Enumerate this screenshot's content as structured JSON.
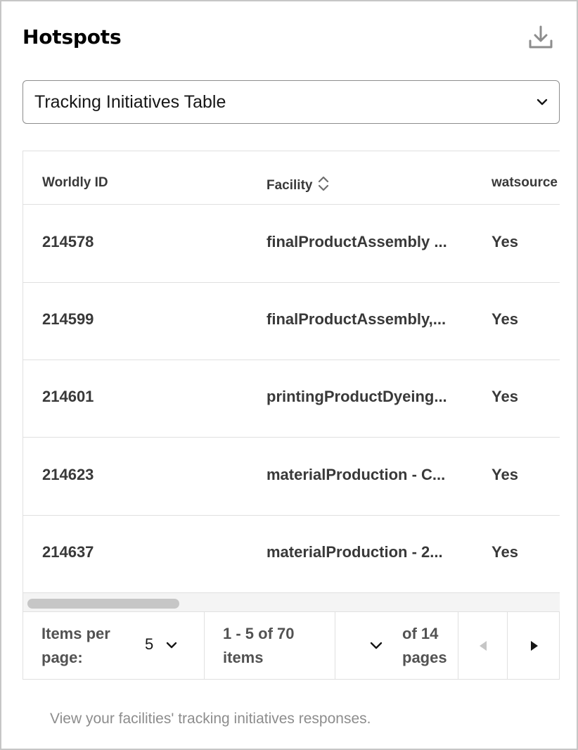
{
  "card": {
    "title": "Hotspots",
    "icons": {
      "download": "download-icon"
    }
  },
  "view_select": {
    "value": "Tracking Initiatives Table"
  },
  "table": {
    "columns": [
      "Worldly ID",
      "Facility",
      "watsource"
    ],
    "rows": [
      {
        "id": "214578",
        "facility": "finalProductAssembly ...",
        "watsource": "Yes"
      },
      {
        "id": "214599",
        "facility": "finalProductAssembly,...",
        "watsource": "Yes"
      },
      {
        "id": "214601",
        "facility": "printingProductDyeing...",
        "watsource": "Yes"
      },
      {
        "id": "214623",
        "facility": "materialProduction - C...",
        "watsource": "Yes"
      },
      {
        "id": "214637",
        "facility": "materialProduction - 2...",
        "watsource": "Yes"
      }
    ]
  },
  "pagination": {
    "items_per_page_label": "Items per page:",
    "items_per_page_value": "5",
    "range_text": "1 - 5 of 70 items",
    "pages_text": "of 14 pages",
    "prev_enabled": false,
    "next_enabled": true
  },
  "footnote": "View your facilities' tracking initiatives responses."
}
